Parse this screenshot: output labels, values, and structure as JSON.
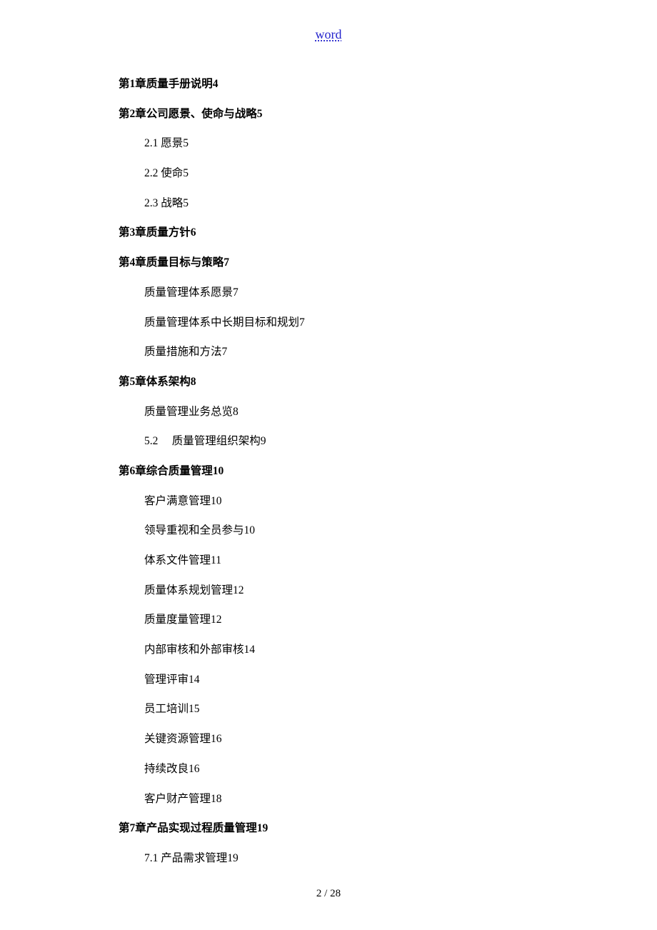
{
  "header": {
    "link_text": "word"
  },
  "toc": [
    {
      "type": "chapter",
      "text": "第1章质量手册说明",
      "page": "4"
    },
    {
      "type": "chapter",
      "text": "第2章公司愿景、使命与战略",
      "page": "5"
    },
    {
      "type": "sub",
      "text": "2.1 愿景",
      "page": "5"
    },
    {
      "type": "sub",
      "text": "2.2 使命",
      "page": "5"
    },
    {
      "type": "sub",
      "text": "2.3 战略",
      "page": "5"
    },
    {
      "type": "chapter",
      "text": "第3章质量方针",
      "page": "6"
    },
    {
      "type": "chapter",
      "text": "第4章质量目标与策略",
      "page": "7"
    },
    {
      "type": "sub",
      "text": "质量管理体系愿景",
      "page": "7"
    },
    {
      "type": "sub",
      "text": "质量管理体系中长期目标和规划",
      "page": "7"
    },
    {
      "type": "sub",
      "text": "质量措施和方法",
      "page": "7"
    },
    {
      "type": "chapter",
      "text": "第5章体系架构",
      "page": "8"
    },
    {
      "type": "sub",
      "text": "质量管理业务总览",
      "page": "8"
    },
    {
      "type": "sub",
      "text": "5.2　 质量管理组织架构",
      "page": "9"
    },
    {
      "type": "chapter",
      "text": "第6章综合质量管理",
      "page": "10"
    },
    {
      "type": "sub",
      "text": "客户满意管理",
      "page": "10"
    },
    {
      "type": "sub",
      "text": "领导重视和全员参与",
      "page": "10"
    },
    {
      "type": "sub",
      "text": "体系文件管理",
      "page": "11"
    },
    {
      "type": "sub",
      "text": "质量体系规划管理",
      "page": "12"
    },
    {
      "type": "sub",
      "text": "质量度量管理",
      "page": "12"
    },
    {
      "type": "sub",
      "text": "内部审核和外部审核",
      "page": "14"
    },
    {
      "type": "sub",
      "text": "管理评审",
      "page": "14"
    },
    {
      "type": "sub",
      "text": "员工培训",
      "page": "15"
    },
    {
      "type": "sub",
      "text": "关键资源管理",
      "page": "16"
    },
    {
      "type": "sub",
      "text": "持续改良",
      "page": "16"
    },
    {
      "type": "sub",
      "text": "客户财产管理",
      "page": "18"
    },
    {
      "type": "chapter",
      "text": "第7章产品实现过程质量管理",
      "page": "19"
    },
    {
      "type": "sub",
      "text": "7.1 产品需求管理",
      "page": "19"
    }
  ],
  "footer": {
    "page_indicator": "2 / 28"
  }
}
